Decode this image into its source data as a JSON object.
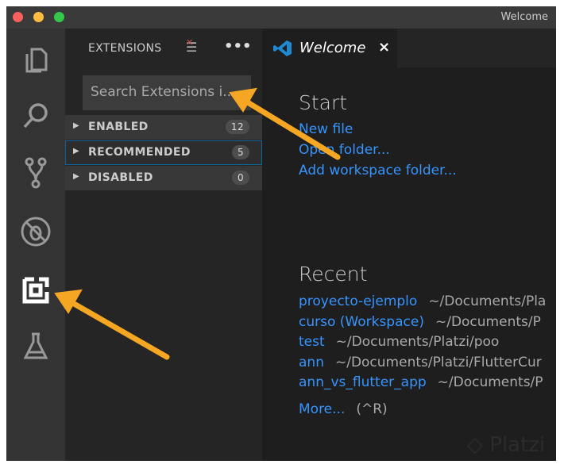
{
  "window": {
    "title": "Welcome",
    "traffic_lights": [
      "#fc605c",
      "#fdbc40",
      "#34c84a"
    ]
  },
  "activity_bar": {
    "items": [
      "explorer-icon",
      "search-icon",
      "source-control-icon",
      "debug-icon",
      "extensions-icon",
      "test-flask-icon"
    ],
    "active": "extensions-icon"
  },
  "sidebar": {
    "title": "EXTENSIONS",
    "search_placeholder": "Search Extensions i...",
    "sections": [
      {
        "label": "ENABLED",
        "count": "12"
      },
      {
        "label": "RECOMMENDED",
        "count": "5"
      },
      {
        "label": "DISABLED",
        "count": "0"
      }
    ]
  },
  "tab": {
    "label": "Welcome",
    "close": "×"
  },
  "welcome": {
    "start_heading": "Start",
    "start_links": [
      "New file",
      "Open folder...",
      "Add workspace folder..."
    ],
    "recent_heading": "Recent",
    "recent": [
      {
        "name": "proyecto-ejemplo",
        "path": "~/Documents/Pla"
      },
      {
        "name": "curso (Workspace)",
        "path": "~/Documents/P"
      },
      {
        "name": "test",
        "path": "~/Documents/Platzi/poo"
      },
      {
        "name": "ann",
        "path": "~/Documents/Platzi/FlutterCur"
      },
      {
        "name": "ann_vs_flutter_app",
        "path": "~/Documents/P"
      }
    ],
    "more": "More...",
    "more_shortcut": "(^R)"
  },
  "watermark": "Platzi",
  "colors": {
    "accent": "#3794ff",
    "annotation_arrow": "#f5a623"
  }
}
